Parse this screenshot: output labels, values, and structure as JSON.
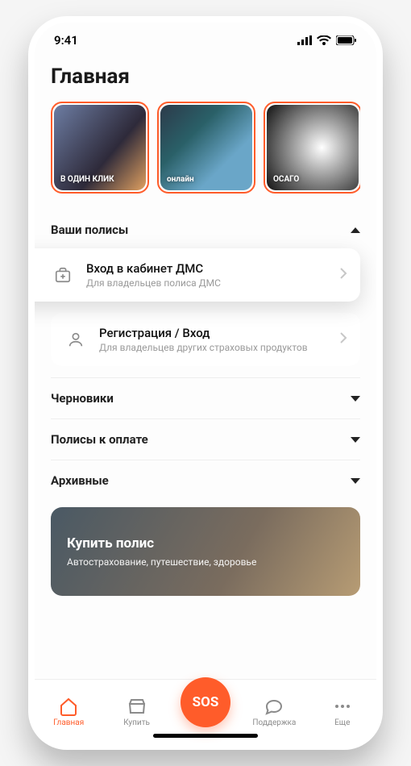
{
  "status": {
    "time": "9:41"
  },
  "page_title": "Главная",
  "stories": [
    {
      "label": "В ОДИН КЛИК"
    },
    {
      "label": "онлайн"
    },
    {
      "label": "ОСАГО"
    },
    {
      "label": ""
    }
  ],
  "policies": {
    "header": "Ваши полисы",
    "dms": {
      "title": "Вход в кабинет ДМС",
      "subtitle": "Для владельцев полиса ДМС"
    },
    "login": {
      "title": "Регистрация / Вход",
      "subtitle": "Для владельцев других страховых продуктов"
    }
  },
  "sections": {
    "drafts": "Черновики",
    "to_pay": "Полисы к оплате",
    "archive": "Архивные"
  },
  "banner": {
    "title": "Купить полис",
    "subtitle": "Автострахование, путешествие, здоровье"
  },
  "tabs": {
    "home": "Главная",
    "buy": "Купить",
    "sos": "SOS",
    "support": "Поддержка",
    "more": "Еще"
  }
}
